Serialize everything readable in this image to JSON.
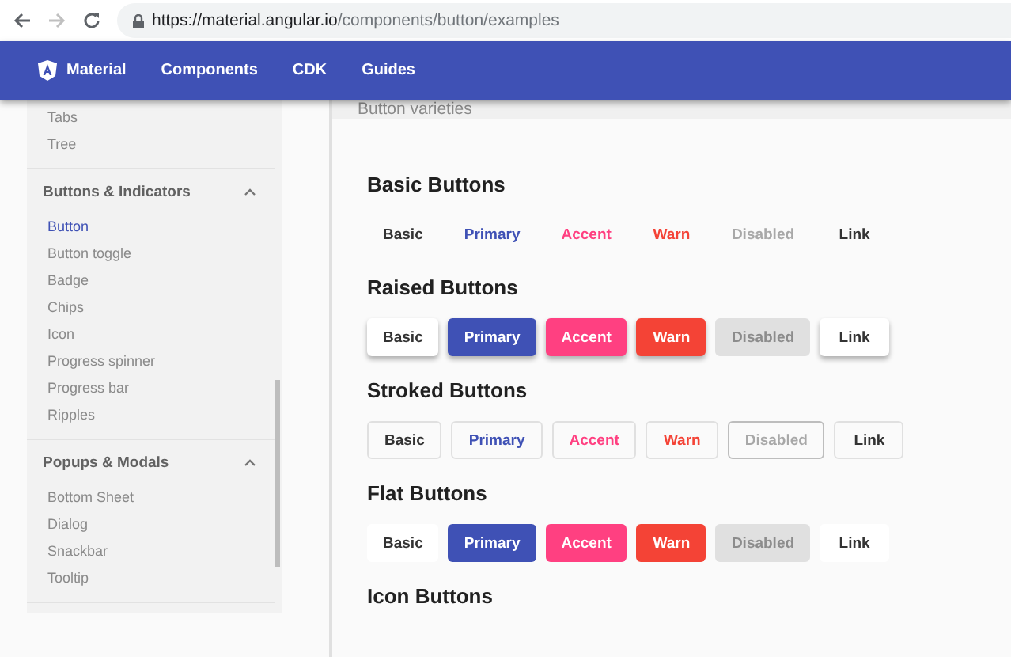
{
  "browser": {
    "url_host": "https://material.angular.io",
    "url_path": "/components/button/examples"
  },
  "toolbar": {
    "brand": "Material",
    "links": [
      "Components",
      "CDK",
      "Guides"
    ]
  },
  "sidebar": {
    "groups": [
      {
        "items": [
          {
            "label": "Tabs",
            "selected": false
          },
          {
            "label": "Tree",
            "selected": false
          }
        ]
      },
      {
        "title": "Buttons & Indicators",
        "expanded": true,
        "items": [
          {
            "label": "Button",
            "selected": true
          },
          {
            "label": "Button toggle",
            "selected": false
          },
          {
            "label": "Badge",
            "selected": false
          },
          {
            "label": "Chips",
            "selected": false
          },
          {
            "label": "Icon",
            "selected": false
          },
          {
            "label": "Progress spinner",
            "selected": false
          },
          {
            "label": "Progress bar",
            "selected": false
          },
          {
            "label": "Ripples",
            "selected": false
          }
        ]
      },
      {
        "title": "Popups & Modals",
        "expanded": true,
        "items": [
          {
            "label": "Bottom Sheet",
            "selected": false
          },
          {
            "label": "Dialog",
            "selected": false
          },
          {
            "label": "Snackbar",
            "selected": false
          },
          {
            "label": "Tooltip",
            "selected": false
          }
        ]
      }
    ]
  },
  "example_header": "Button varieties",
  "sections": [
    {
      "title": "Basic Buttons",
      "kind": "text",
      "buttons": [
        {
          "label": "Basic",
          "kind": "basic",
          "disabled": false
        },
        {
          "label": "Primary",
          "kind": "primary",
          "disabled": false
        },
        {
          "label": "Accent",
          "kind": "accent",
          "disabled": false
        },
        {
          "label": "Warn",
          "kind": "warn",
          "disabled": false
        },
        {
          "label": "Disabled",
          "kind": "basic",
          "disabled": true
        },
        {
          "label": "Link",
          "kind": "basic",
          "disabled": false
        }
      ]
    },
    {
      "title": "Raised Buttons",
      "kind": "raised",
      "buttons": [
        {
          "label": "Basic",
          "kind": "basic",
          "disabled": false
        },
        {
          "label": "Primary",
          "kind": "primary",
          "disabled": false
        },
        {
          "label": "Accent",
          "kind": "accent",
          "disabled": false
        },
        {
          "label": "Warn",
          "kind": "warn",
          "disabled": false
        },
        {
          "label": "Disabled",
          "kind": "basic",
          "disabled": true
        },
        {
          "label": "Link",
          "kind": "basic",
          "disabled": false
        }
      ]
    },
    {
      "title": "Stroked Buttons",
      "kind": "stroked",
      "buttons": [
        {
          "label": "Basic",
          "kind": "basic",
          "disabled": false
        },
        {
          "label": "Primary",
          "kind": "primary",
          "disabled": false
        },
        {
          "label": "Accent",
          "kind": "accent",
          "disabled": false
        },
        {
          "label": "Warn",
          "kind": "warn",
          "disabled": false
        },
        {
          "label": "Disabled",
          "kind": "basic",
          "disabled": true
        },
        {
          "label": "Link",
          "kind": "basic",
          "disabled": false
        }
      ]
    },
    {
      "title": "Flat Buttons",
      "kind": "flat",
      "buttons": [
        {
          "label": "Basic",
          "kind": "basic",
          "disabled": false
        },
        {
          "label": "Primary",
          "kind": "primary",
          "disabled": false
        },
        {
          "label": "Accent",
          "kind": "accent",
          "disabled": false
        },
        {
          "label": "Warn",
          "kind": "warn",
          "disabled": false
        },
        {
          "label": "Disabled",
          "kind": "basic",
          "disabled": true
        },
        {
          "label": "Link",
          "kind": "basic",
          "disabled": false
        }
      ]
    },
    {
      "title": "Icon Buttons"
    }
  ]
}
